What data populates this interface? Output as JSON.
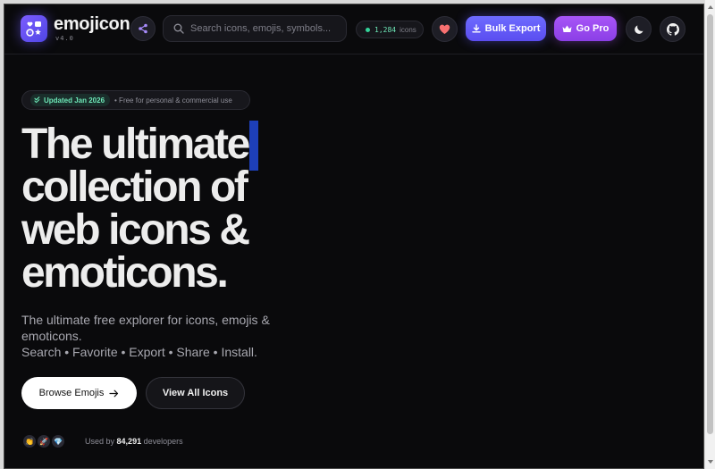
{
  "header": {
    "brand_name": "emojicon",
    "brand_version": "v4.0",
    "search_placeholder": "Search icons, emojis, symbols...",
    "icon_count": "1,284",
    "icon_count_label": "icons",
    "bulk_export_label": "Bulk Export",
    "go_pro_label": "Go Pro",
    "icons": {
      "share": "share-nodes-icon",
      "search": "magnifier-icon",
      "favorites": "heart-icon",
      "bulk_export": "download-icon",
      "go_pro": "crown-icon",
      "theme": "moon-icon",
      "github": "github-icon"
    }
  },
  "hero": {
    "badge_tag": "Updated Jan 2026",
    "badge_text": "• Free for personal & commercial use",
    "title_lines": [
      "The ultimate",
      "collection of",
      "web icons &",
      "emoticons."
    ],
    "subtitle": "The ultimate free explorer for icons, emojis & emoticons.",
    "subtitle_actions": "Search • Favorite • Export • Share • Install.",
    "browse_label": "Browse Emojis",
    "view_all_label": "View All Icons",
    "avatar_emojis": [
      "👏",
      "🚀",
      "💎"
    ],
    "used_by_prefix": "Used by",
    "used_by_count": "84,291",
    "used_by_suffix": "developers"
  },
  "colors": {
    "background": "#0a0a0c",
    "accent_indigo": "#5b4df0",
    "accent_purple": "#a855f7",
    "status_green": "#34d399",
    "heart_red": "#f87171",
    "caret_blue": "#1d3fb8"
  }
}
